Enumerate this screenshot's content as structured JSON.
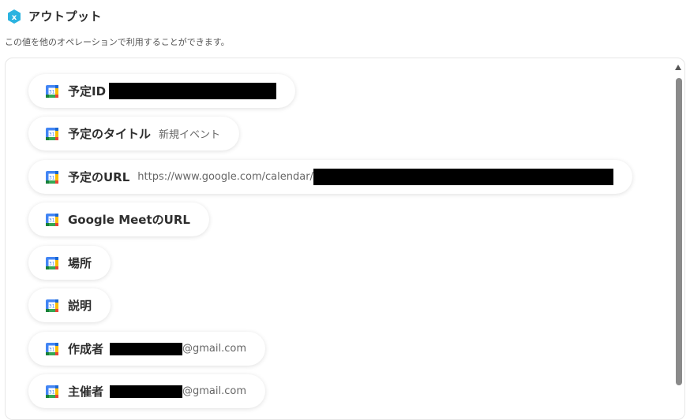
{
  "header": {
    "title": "アウトプット",
    "description": "この値を他のオペレーションで利用することができます。"
  },
  "outputs": [
    {
      "label": "予定ID",
      "value": ""
    },
    {
      "label": "予定のタイトル",
      "value": "新規イベント"
    },
    {
      "label": "予定のURL",
      "value": "https://www.google.com/calendar/"
    },
    {
      "label": "Google MeetのURL",
      "value": ""
    },
    {
      "label": "場所",
      "value": ""
    },
    {
      "label": "説明",
      "value": ""
    },
    {
      "label": "作成者",
      "value": "@gmail.com"
    },
    {
      "label": "主催者",
      "value": "@gmail.com"
    }
  ],
  "icons": {
    "header_icon": "hexagon-x-icon",
    "item_icon": "google-calendar-icon"
  },
  "colors": {
    "accent": "#2bb3e0",
    "redaction": "#000000"
  }
}
